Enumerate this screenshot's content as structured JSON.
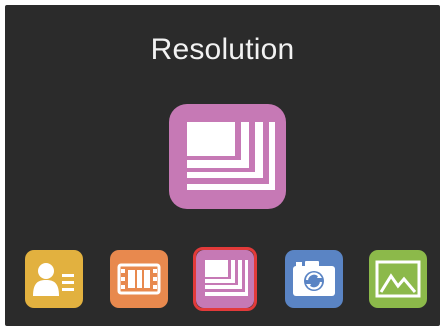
{
  "screen": {
    "title": "Resolution",
    "preview_icon": "resolution-icon"
  },
  "menu": {
    "selected": "resolution",
    "items": [
      {
        "id": "profile",
        "icon": "user-profile-icon",
        "color": "#e2b13f"
      },
      {
        "id": "video",
        "icon": "film-icon",
        "color": "#e8894e"
      },
      {
        "id": "resolution",
        "icon": "resolution-icon",
        "color": "#c679b5"
      },
      {
        "id": "camera",
        "icon": "camera-rotate-icon",
        "color": "#5a84c4"
      },
      {
        "id": "photo",
        "icon": "photo-icon",
        "color": "#8cb94a"
      }
    ]
  },
  "colors": {
    "background": "#2b2b2b",
    "title": "#f2f2f2",
    "selection": "#e23a3a",
    "glyph": "#ffffff"
  }
}
